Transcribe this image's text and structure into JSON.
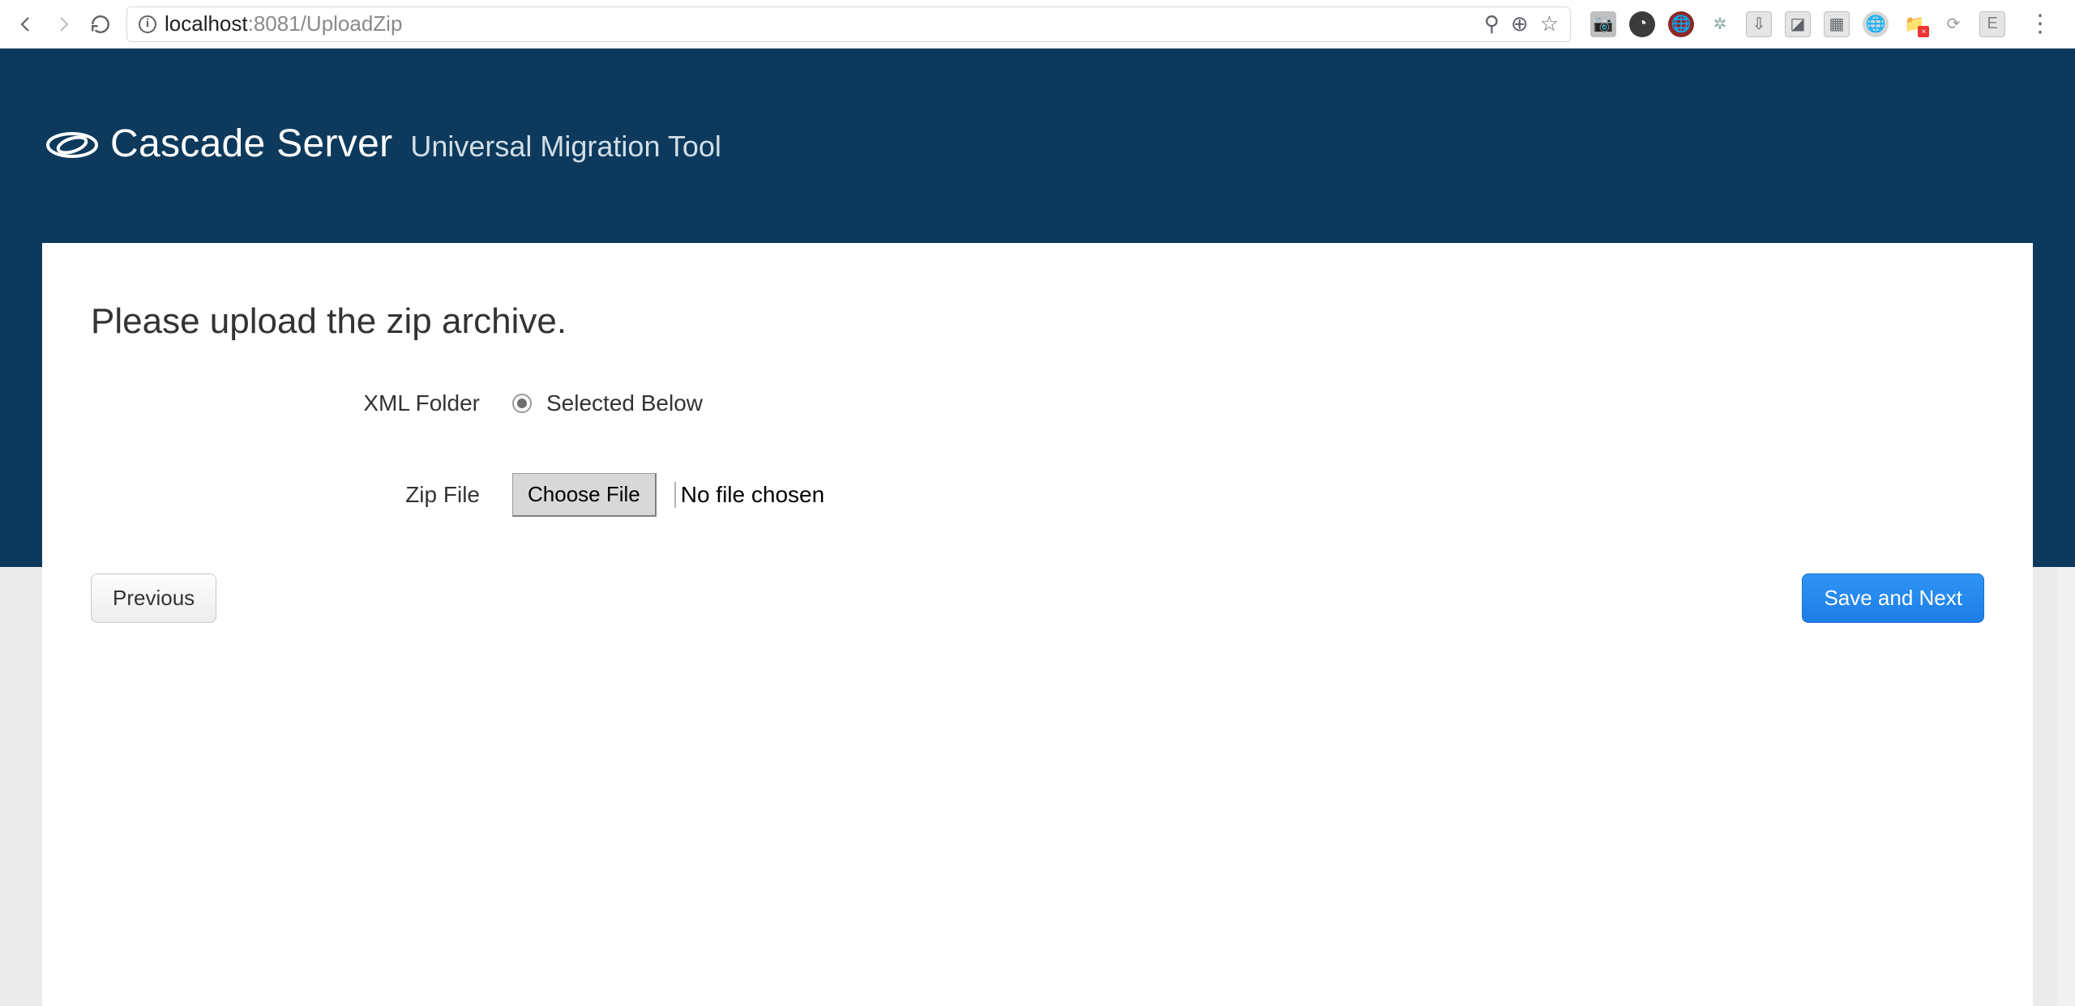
{
  "browser": {
    "url_host": "localhost",
    "url_rest": ":8081/UploadZip",
    "info_glyph": "i",
    "pin_glyph": "⚲",
    "zoom_glyph": "⊕",
    "star_glyph": "☆",
    "menu_glyph": "⋮"
  },
  "brand": {
    "main": "Cascade Server",
    "sub": "Universal Migration Tool"
  },
  "page": {
    "heading": "Please upload the zip archive.",
    "xml_folder_label": "XML Folder",
    "xml_folder_option": "Selected Below",
    "zip_file_label": "Zip File",
    "choose_file_label": "Choose File",
    "file_status": "No file chosen",
    "previous_label": "Previous",
    "save_next_label": "Save and Next"
  }
}
